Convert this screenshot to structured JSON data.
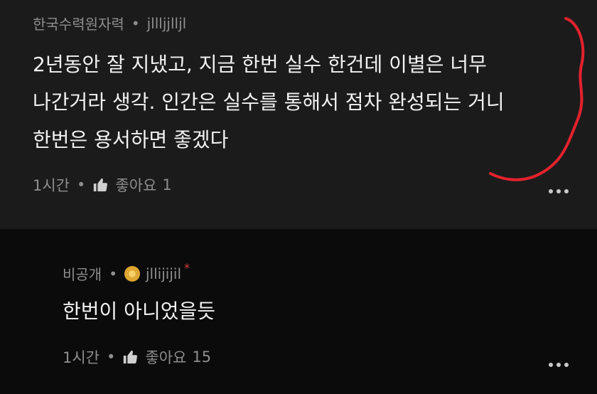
{
  "comment": {
    "author_group": "한국수력원자력",
    "username": "jllljjlljl",
    "body_lines": [
      "2년동안 잘 지냈고, 지금 한번 실수 한건데 이별은 너무",
      "나간거라 생각.  인간은 실수를 통해서 점차 완성되는 거니",
      "한번은 용서하면 좋겠다"
    ],
    "time": "1시간",
    "like_label": "좋아요",
    "like_count": "1"
  },
  "reply": {
    "author_group": "비공개",
    "username": "jllijijil",
    "op_marker": "*",
    "body": "한번이 아니었을듯",
    "time": "1시간",
    "like_label": "좋아요",
    "like_count": "15"
  },
  "separator": "•",
  "colors": {
    "comment_bg": "#1b1b1c",
    "reply_bg": "#0b0b0b",
    "annotation_stroke": "#e4222c"
  },
  "icons": [
    "thumbs-up-icon",
    "more-dots-icon",
    "user-badge-icon"
  ]
}
